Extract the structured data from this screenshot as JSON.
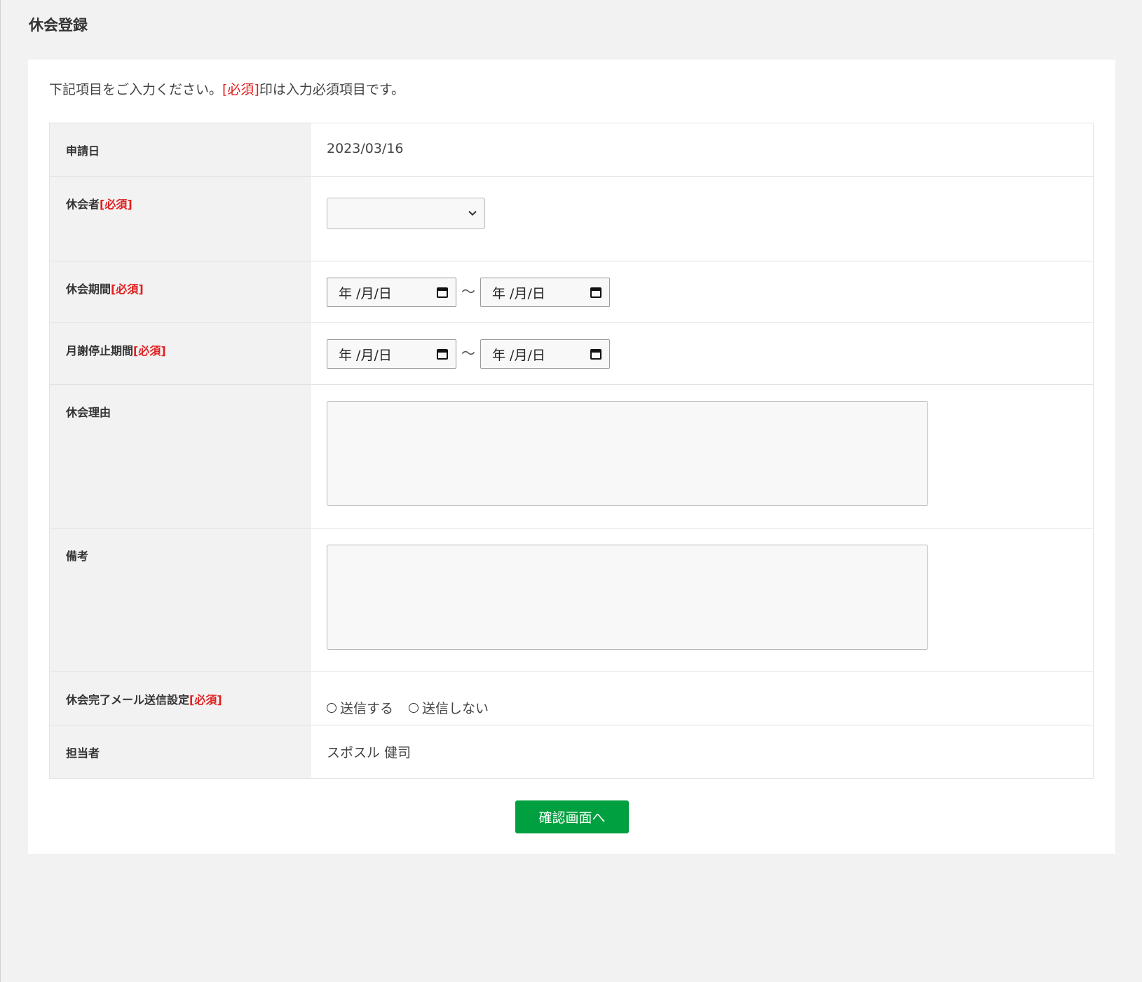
{
  "page": {
    "title": "休会登録"
  },
  "intro": {
    "before": "下記項目をご入力ください。",
    "required_mark": "[必須]",
    "after": "印は入力必須項目です。"
  },
  "required_tag": "[必須]",
  "fields": {
    "application_date": {
      "label": "申請日",
      "value": "2023/03/16"
    },
    "member": {
      "label": "休会者",
      "selected": ""
    },
    "leave_period": {
      "label": "休会期間",
      "start_placeholder": "年 /月/日",
      "end_placeholder": "年 /月/日",
      "separator": "〜"
    },
    "fee_stop_period": {
      "label": "月謝停止期間",
      "start_placeholder": "年 /月/日",
      "end_placeholder": "年 /月/日",
      "separator": "〜"
    },
    "reason": {
      "label": "休会理由",
      "value": ""
    },
    "notes": {
      "label": "備考",
      "value": ""
    },
    "mail_setting": {
      "label": "休会完了メール送信設定",
      "options": [
        "送信する",
        "送信しない"
      ]
    },
    "staff": {
      "label": "担当者",
      "value": "スポスル 健司"
    }
  },
  "submit": {
    "label": "確認画面へ"
  },
  "colors": {
    "accent_green": "#00a040",
    "required_red": "#e02020",
    "label_bg": "#f2f2f2"
  },
  "icons": {
    "select_arrow": "chevron-down-icon",
    "date_picker": "calendar-icon"
  }
}
